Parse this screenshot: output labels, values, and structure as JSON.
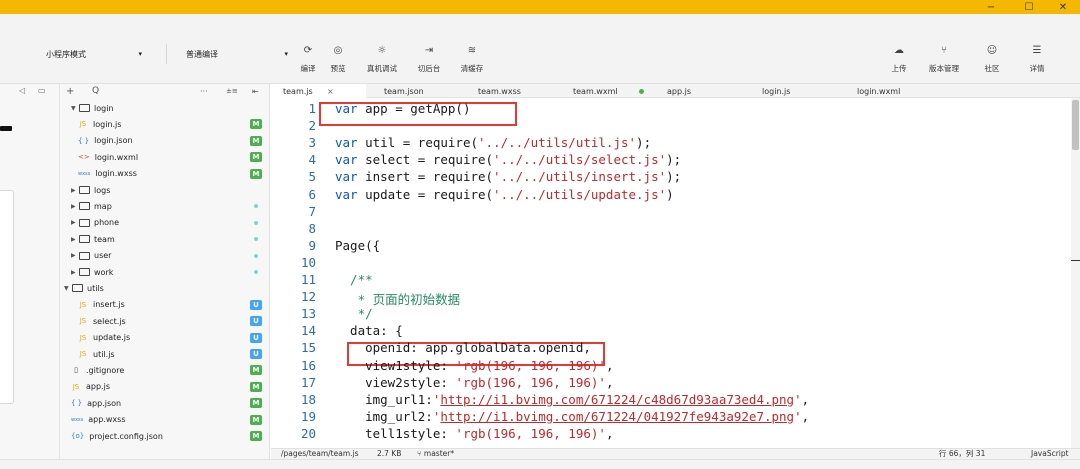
{
  "window": {
    "minimize": "−",
    "maximize": "☐",
    "close": "✕"
  },
  "toolbar": {
    "mode_select": "小程序模式",
    "compile_select": "普通编译",
    "buttons": [
      {
        "icon": "⟳",
        "label": "编译"
      },
      {
        "icon": "◎",
        "label": "预览"
      },
      {
        "icon": "☼",
        "label": "真机调试"
      },
      {
        "icon": "⇥",
        "label": "切后台"
      },
      {
        "icon": "≋",
        "label": "清缓存"
      }
    ],
    "right_buttons": [
      {
        "icon": "☁",
        "label": "上传"
      },
      {
        "icon": "⑂",
        "label": "版本管理"
      },
      {
        "icon": "☺",
        "label": "社区"
      },
      {
        "icon": "☰",
        "label": "详情"
      }
    ]
  },
  "tree": {
    "add": "+",
    "search": "Q",
    "more": "···",
    "sort": "±≡",
    "collapse": "⇤",
    "items": [
      {
        "name": "login",
        "type": "folder-open",
        "indent": 1
      },
      {
        "name": "login.js",
        "type": "js",
        "indent": 2,
        "badge": "M"
      },
      {
        "name": "login.json",
        "type": "json",
        "indent": 2,
        "badge": "M"
      },
      {
        "name": "login.wxml",
        "type": "wxml",
        "indent": 2,
        "badge": "M"
      },
      {
        "name": "login.wxss",
        "type": "wxss",
        "indent": 2,
        "badge": "M"
      },
      {
        "name": "logs",
        "type": "folder",
        "indent": 1
      },
      {
        "name": "map",
        "type": "folder",
        "indent": 1,
        "dot": true
      },
      {
        "name": "phone",
        "type": "folder",
        "indent": 1,
        "dot": true
      },
      {
        "name": "team",
        "type": "folder",
        "indent": 1,
        "dot": true
      },
      {
        "name": "user",
        "type": "folder",
        "indent": 1,
        "dot": true
      },
      {
        "name": "work",
        "type": "folder",
        "indent": 1,
        "dot": true
      },
      {
        "name": "utils",
        "type": "folder-open",
        "indent": 0
      },
      {
        "name": "insert.js",
        "type": "js",
        "indent": 2,
        "badge": "U"
      },
      {
        "name": "select.js",
        "type": "js",
        "indent": 2,
        "badge": "U"
      },
      {
        "name": "update.js",
        "type": "js",
        "indent": 2,
        "badge": "U"
      },
      {
        "name": "util.js",
        "type": "js",
        "indent": 2,
        "badge": "U"
      },
      {
        "name": ".gitignore",
        "type": "file",
        "indent": 1,
        "badge": "M"
      },
      {
        "name": "app.js",
        "type": "js",
        "indent": 1,
        "badge": "M"
      },
      {
        "name": "app.json",
        "type": "json",
        "indent": 1,
        "badge": "M"
      },
      {
        "name": "app.wxss",
        "type": "wxss",
        "indent": 1,
        "badge": "M"
      },
      {
        "name": "project.config.json",
        "type": "config",
        "indent": 1,
        "badge": "M"
      }
    ]
  },
  "icons": {
    "js": "JS",
    "json": "{ }",
    "wxml": "<>",
    "wxss": "wxss",
    "file": "▯",
    "config": "{o}"
  },
  "tabs": [
    {
      "label": "team.js",
      "active": true,
      "close": "×"
    },
    {
      "label": "team.json"
    },
    {
      "label": "team.wxss"
    },
    {
      "label": "team.wxml",
      "dot": true
    },
    {
      "label": "app.js"
    },
    {
      "label": "login.js"
    },
    {
      "label": "login.wxml"
    }
  ],
  "code": [
    {
      "n": "1",
      "segs": [
        {
          "t": "var ",
          "c": "kw"
        },
        {
          "t": "app = getApp()"
        }
      ]
    },
    {
      "n": "2",
      "segs": []
    },
    {
      "n": "3",
      "segs": [
        {
          "t": "var ",
          "c": "kw"
        },
        {
          "t": "util = require("
        },
        {
          "t": "'../../utils/util.js'",
          "c": "str"
        },
        {
          "t": ");"
        }
      ]
    },
    {
      "n": "4",
      "segs": [
        {
          "t": "var ",
          "c": "kw"
        },
        {
          "t": "select = require("
        },
        {
          "t": "'../../utils/select.js'",
          "c": "str"
        },
        {
          "t": ");"
        }
      ]
    },
    {
      "n": "5",
      "segs": [
        {
          "t": "var ",
          "c": "kw"
        },
        {
          "t": "insert = require("
        },
        {
          "t": "'../../utils/insert.js'",
          "c": "str"
        },
        {
          "t": ");"
        }
      ]
    },
    {
      "n": "6",
      "segs": [
        {
          "t": "var ",
          "c": "kw"
        },
        {
          "t": "update = require("
        },
        {
          "t": "'../../utils/update.js'",
          "c": "str"
        },
        {
          "t": ")"
        }
      ]
    },
    {
      "n": "7",
      "segs": []
    },
    {
      "n": "8",
      "segs": []
    },
    {
      "n": "9",
      "segs": [
        {
          "t": "Page({"
        }
      ]
    },
    {
      "n": "10",
      "segs": []
    },
    {
      "n": "11",
      "segs": [
        {
          "t": "  /**",
          "c": "cmt"
        }
      ]
    },
    {
      "n": "12",
      "segs": [
        {
          "t": "   * 页面的初始数据",
          "c": "cmt"
        }
      ]
    },
    {
      "n": "13",
      "segs": [
        {
          "t": "   */",
          "c": "cmt"
        }
      ]
    },
    {
      "n": "14",
      "segs": [
        {
          "t": "  data: {"
        }
      ]
    },
    {
      "n": "15",
      "segs": [
        {
          "t": "    openid: app.globalData.openid,"
        }
      ]
    },
    {
      "n": "16",
      "segs": [
        {
          "t": "    view1style: "
        },
        {
          "t": "'rgb(196, 196, 196)'",
          "c": "str"
        },
        {
          "t": ","
        }
      ]
    },
    {
      "n": "17",
      "segs": [
        {
          "t": "    view2style: "
        },
        {
          "t": "'rgb(196, 196, 196)'",
          "c": "str"
        },
        {
          "t": ","
        }
      ]
    },
    {
      "n": "18",
      "segs": [
        {
          "t": "    img_url1:"
        },
        {
          "t": "'"
        },
        {
          "t": "http://i1.bvimg.com/671224/c48d67d93aa73ed4.png",
          "c": "url"
        },
        {
          "t": "'",
          "c": "str"
        },
        {
          "t": ","
        }
      ]
    },
    {
      "n": "19",
      "segs": [
        {
          "t": "    img_url2:"
        },
        {
          "t": "'"
        },
        {
          "t": "http://i1.bvimg.com/671224/041927fe943a92e7.png",
          "c": "url"
        },
        {
          "t": "'",
          "c": "str"
        },
        {
          "t": ","
        }
      ]
    },
    {
      "n": "20",
      "segs": [
        {
          "t": "    tell1style: "
        },
        {
          "t": "'rgb(196, 196, 196)'",
          "c": "str"
        },
        {
          "t": ","
        }
      ]
    }
  ],
  "status": {
    "path": "/pages/team/team.js",
    "size": "2.7 KB",
    "branch": "⑂ master*",
    "position": "行 66，列 31",
    "language": "JavaScript"
  },
  "colors": {
    "titlebar": "#f5b800",
    "badge_m": "#4caf50",
    "badge_u": "#42a5f5",
    "highlight": "#e53935"
  }
}
